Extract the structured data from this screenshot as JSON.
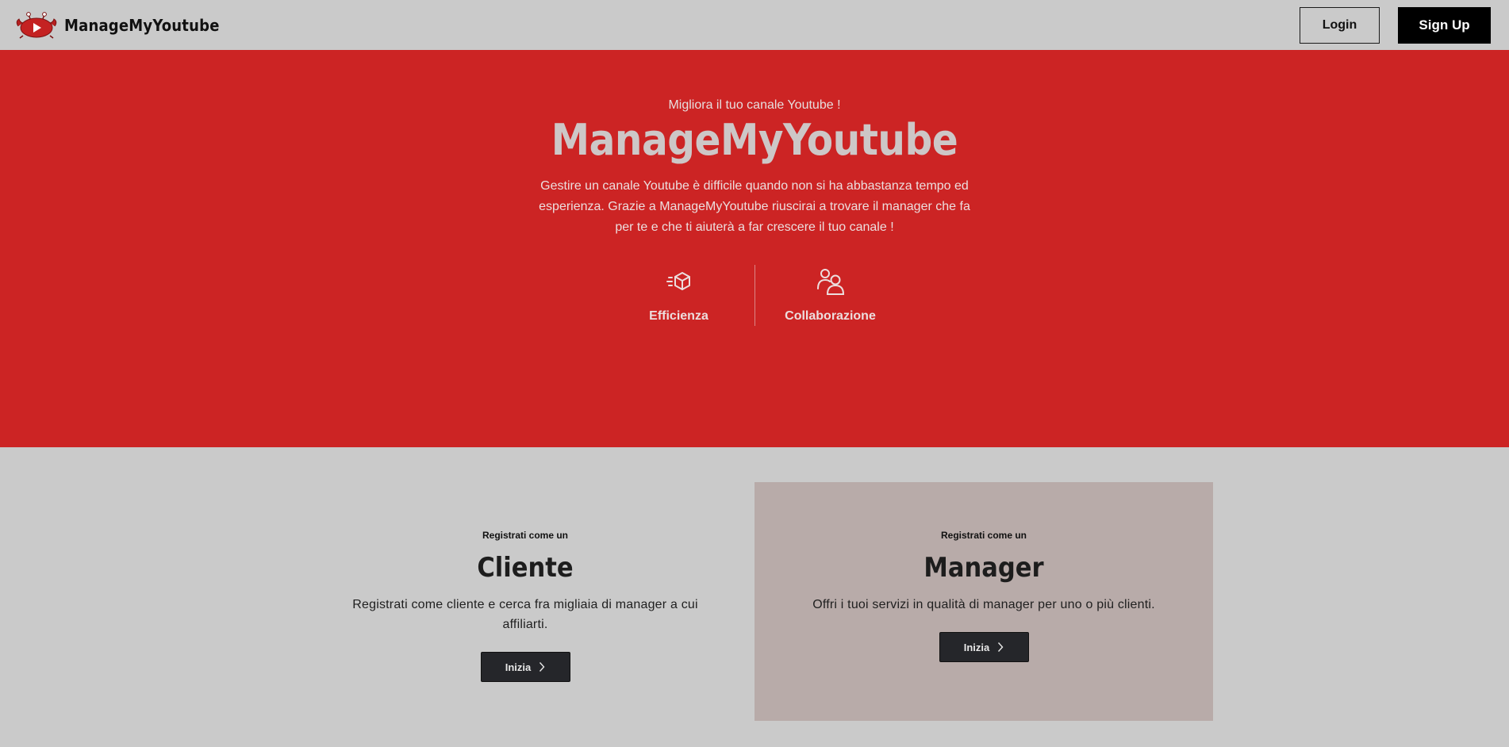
{
  "nav": {
    "brand": "ManageMyYoutube",
    "login_label": "Login",
    "signup_label": "Sign Up"
  },
  "hero": {
    "eyebrow": "Migliora il tuo canale Youtube !",
    "title": "ManageMyYoutube",
    "description": "Gestire un canale Youtube è difficile quando non si ha abbastanza tempo ed esperienza. Grazie a ManageMyYoutube riuscirai a trovare il manager che fa per te e che ti aiuterà a far crescere il tuo canale !",
    "features": [
      {
        "icon": "fast-box-icon",
        "label": "Efficienza"
      },
      {
        "icon": "users-icon",
        "label": "Collaborazione"
      }
    ]
  },
  "cards": [
    {
      "eyebrow": "Registrati come un",
      "title": "Cliente",
      "description": "Registrati come cliente e cerca fra migliaia di manager a cui affiliarti.",
      "button_label": "Inizia"
    },
    {
      "eyebrow": "Registrati come un",
      "title": "Manager",
      "description": "Offri i tuoi servizi in qualità di manager per uno o più clienti.",
      "button_label": "Inizia"
    }
  ],
  "colors": {
    "hero_bg": "#cc2424",
    "page_bg": "#cacaca",
    "manager_card_bg": "#b8aba9",
    "button_dark": "#25262a"
  }
}
